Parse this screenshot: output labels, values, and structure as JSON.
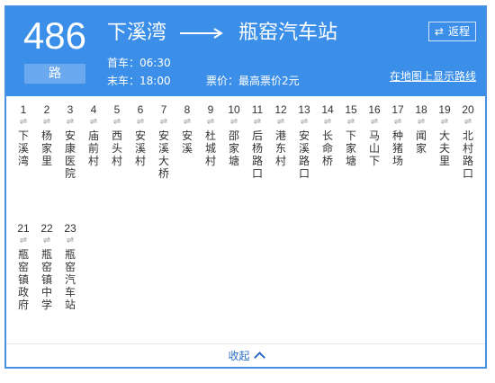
{
  "route": {
    "number": "486",
    "unit": "路",
    "from": "下溪湾",
    "to": "瓶窑汽车站",
    "first_bus": "首车：06:30",
    "last_bus": "末车：18:00",
    "fare": "票价：最高票价2元",
    "return_label": "返程",
    "map_link": "在地图上显示路线"
  },
  "stops": [
    {
      "num": "1",
      "name": "下溪湾"
    },
    {
      "num": "2",
      "name": "杨家里"
    },
    {
      "num": "3",
      "name": "安康医院"
    },
    {
      "num": "4",
      "name": "庙前村"
    },
    {
      "num": "5",
      "name": "西头村"
    },
    {
      "num": "6",
      "name": "安溪村"
    },
    {
      "num": "7",
      "name": "安溪大桥"
    },
    {
      "num": "8",
      "name": "安溪"
    },
    {
      "num": "9",
      "name": "杜城村"
    },
    {
      "num": "10",
      "name": "邵家塘"
    },
    {
      "num": "11",
      "name": "后杨路口"
    },
    {
      "num": "12",
      "name": "港东村"
    },
    {
      "num": "13",
      "name": "安溪路口"
    },
    {
      "num": "14",
      "name": "长命桥"
    },
    {
      "num": "15",
      "name": "下家塘"
    },
    {
      "num": "16",
      "name": "马山下"
    },
    {
      "num": "17",
      "name": "种猪场"
    },
    {
      "num": "18",
      "name": "闻家"
    },
    {
      "num": "19",
      "name": "大夫里"
    },
    {
      "num": "20",
      "name": "北村路口"
    },
    {
      "num": "21",
      "name": "瓶窑镇政府"
    },
    {
      "num": "22",
      "name": "瓶窑镇中学"
    },
    {
      "num": "23",
      "name": "瓶窑汽车站"
    }
  ],
  "footer": {
    "collapse_label": "收起"
  }
}
